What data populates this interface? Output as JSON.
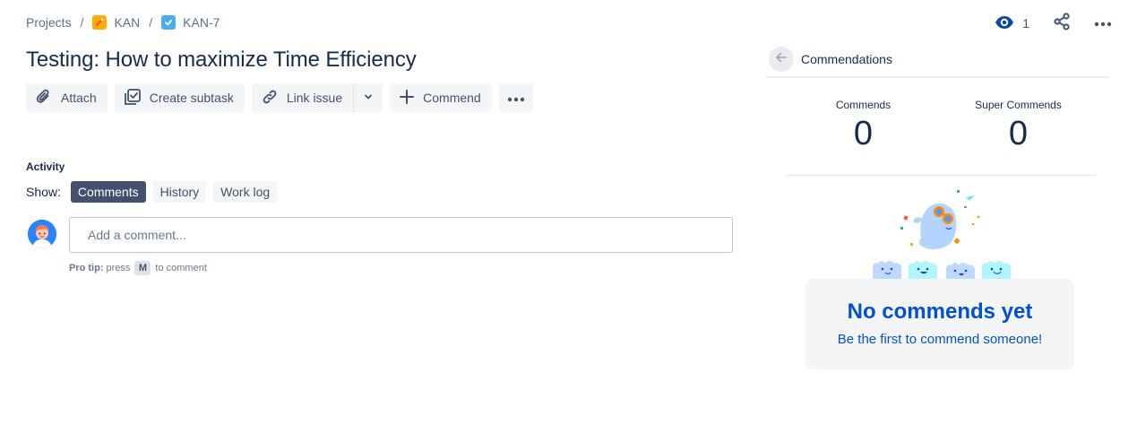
{
  "breadcrumb": {
    "projects": "Projects",
    "separator": "/",
    "project": "KAN",
    "issue": "KAN-7"
  },
  "header_actions": {
    "watch_count": "1",
    "watch_icon": "eye-icon",
    "share_icon": "share-icon",
    "more_icon": "more-horizontal-icon"
  },
  "issue": {
    "title": "Testing: How to maximize Time Efficiency"
  },
  "toolbar": {
    "attach_label": "Attach",
    "create_subtask_label": "Create subtask",
    "link_issue_label": "Link issue",
    "commend_label": "Commend"
  },
  "activity": {
    "heading": "Activity",
    "show_label": "Show:",
    "filters": [
      {
        "label": "Comments",
        "active": true
      },
      {
        "label": "History",
        "active": false
      },
      {
        "label": "Work log",
        "active": false
      }
    ],
    "comment_placeholder": "Add a comment...",
    "pro_tip_label": "Pro tip:",
    "pro_tip_pre": "press",
    "pro_tip_key": "M",
    "pro_tip_post": "to comment"
  },
  "commendations": {
    "title": "Commendations",
    "stats": [
      {
        "label": "Commends",
        "value": "0"
      },
      {
        "label": "Super Commends",
        "value": "0"
      }
    ],
    "empty_title": "No commends yet",
    "empty_subtitle": "Be the first to commend someone!"
  },
  "colors": {
    "primary_text": "#172b4d",
    "link_blue": "#0052cc",
    "chip_active": "#42526e",
    "button_bg": "#f4f5f7",
    "project_icon": "#ffab00",
    "task_icon": "#4bade8"
  }
}
